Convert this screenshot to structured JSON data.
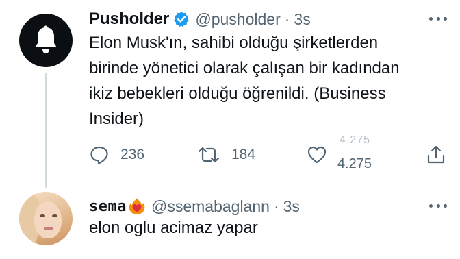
{
  "tweet1": {
    "display_name": "Pusholder",
    "handle": "@pusholder",
    "separator": "·",
    "time": "3s",
    "text": "Elon Musk'ın, sahibi olduğu şirketlerden\nbirinde yönetici olarak çalışan bir kadından\nikiz bebekleri olduğu  öğrenildi. (Business\nInsider)",
    "avatar_icon": "bell-icon",
    "verified_icon": "verified-badge-icon",
    "actions": {
      "reply_count": "236",
      "retweet_count": "184",
      "like_count": "4.275",
      "like_count_ghost": "4.275"
    }
  },
  "tweet2": {
    "display_name": "sema",
    "handle": "@ssemabaglann",
    "separator": "·",
    "time": "3s",
    "text": "elon oglu acimaz yapar",
    "name_emoji": "heart-on-fire-icon"
  },
  "colors": {
    "text_primary": "#0f1419",
    "text_secondary": "#536471",
    "verified": "#1d9bf0",
    "thread_line": "#cfd9de",
    "avatar_bg": "#0b0e13"
  }
}
